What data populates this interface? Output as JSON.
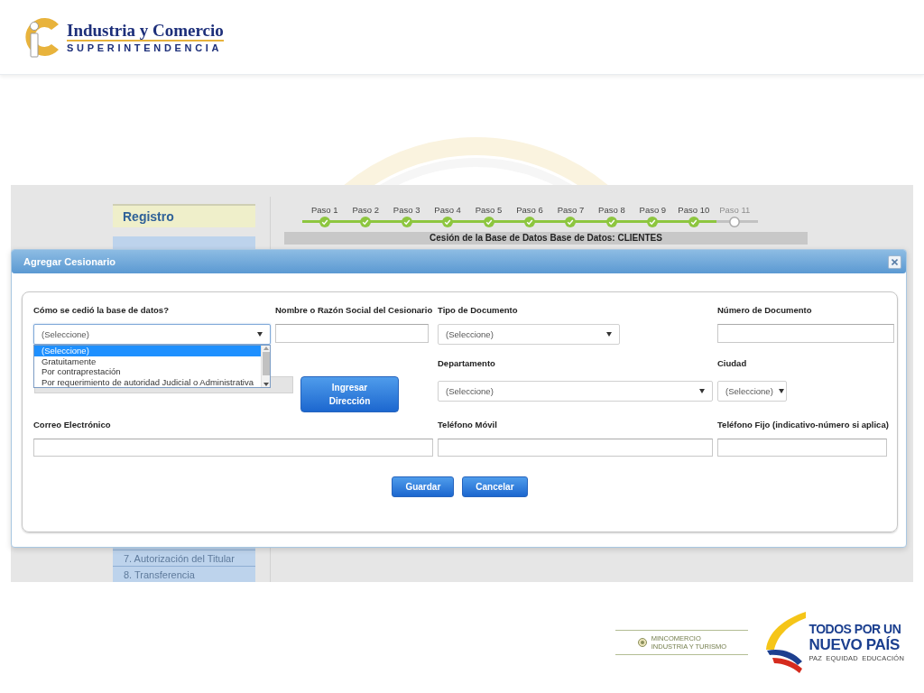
{
  "header": {
    "logo_title": "Industria y Comercio",
    "logo_subtitle": "SUPERINTENDENCIA"
  },
  "app": {
    "sidebar": {
      "title": "Registro",
      "items": [
        {
          "label": "7. Autorización del Titular"
        },
        {
          "label": "8. Transferencia"
        }
      ]
    },
    "stepper": {
      "steps": [
        {
          "label": "Paso 1",
          "completed": true
        },
        {
          "label": "Paso 2",
          "completed": true
        },
        {
          "label": "Paso 3",
          "completed": true
        },
        {
          "label": "Paso 4",
          "completed": true
        },
        {
          "label": "Paso 5",
          "completed": true
        },
        {
          "label": "Paso 6",
          "completed": true
        },
        {
          "label": "Paso 7",
          "completed": true
        },
        {
          "label": "Paso 8",
          "completed": true
        },
        {
          "label": "Paso 9",
          "completed": true
        },
        {
          "label": "Paso 10",
          "completed": true
        },
        {
          "label": "Paso 11",
          "completed": false
        }
      ]
    },
    "section_title": "Cesión de la Base de Datos Base de Datos: CLIENTES"
  },
  "dialog": {
    "title": "Agregar Cesionario",
    "fields": [
      {
        "kind": "select",
        "label": "Cómo se cedió la base de datos?",
        "value": "(Seleccione)",
        "expanded": true,
        "options": [
          {
            "label": "(Seleccione)",
            "selected": true
          },
          {
            "label": "Gratuitamente",
            "selected": false
          },
          {
            "label": "Por contraprestación",
            "selected": false
          },
          {
            "label": "Por requerimiento de autoridad Judicial o Administrativa",
            "selected": false
          }
        ]
      },
      {
        "kind": "text",
        "label": "Nombre o Razón Social del Cesionario"
      },
      {
        "kind": "select",
        "label": "Tipo de Documento",
        "value": "(Seleccione)",
        "expanded": false
      },
      {
        "kind": "text",
        "label": "Número de Documento"
      },
      {
        "kind": "address"
      },
      {
        "kind": "button",
        "label": "Ingresar Dirección"
      },
      {
        "kind": "select",
        "label": "Departamento",
        "value": "(Seleccione)",
        "expanded": false
      },
      {
        "kind": "select",
        "label": "Ciudad",
        "value": "(Seleccione)",
        "expanded": false
      },
      {
        "kind": "text",
        "label": "Correo Electrónico"
      },
      {
        "kind": "text",
        "label": "Teléfono Móvil"
      },
      {
        "kind": "text",
        "label": "Teléfono Fijo (indicativo-número si aplica)"
      }
    ],
    "buttons": [
      "Guardar",
      "Cancelar"
    ]
  },
  "footer": {
    "ministry": [
      "MINCOMERCIO",
      "INDUSTRIA Y TURISMO"
    ],
    "campaign": {
      "line_1": "TODOS POR UN",
      "line_2": "NUEVO PAÍS",
      "tagline": "PAZ EQUIDAD EDUCACIÓN"
    }
  }
}
